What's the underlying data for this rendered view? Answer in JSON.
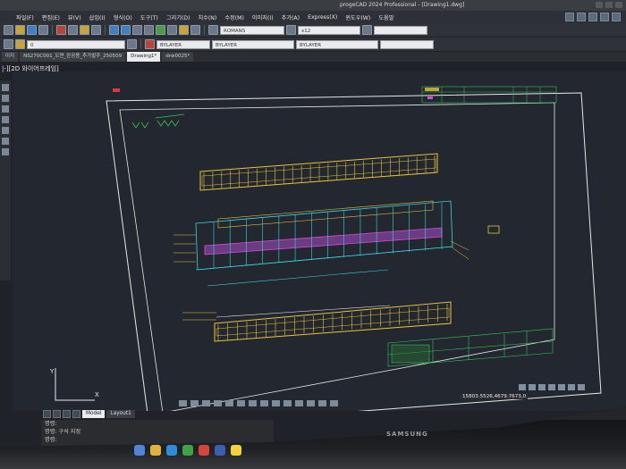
{
  "window": {
    "title": "progeCAD 2024 Professional - [Drawing1.dwg]"
  },
  "menu": {
    "items": [
      "파일(F)",
      "편집(E)",
      "뷰(V)",
      "삽입(I)",
      "형식(O)",
      "도구(T)",
      "그리기(D)",
      "치수(N)",
      "수정(M)",
      "이미지(I)",
      "추가(A)",
      "Express(X)",
      "윈도우(W)",
      "도움말"
    ]
  },
  "toolbar": {
    "font_combo": "ROMANS",
    "scale_combo": "x12",
    "color_combo": "BYLAYER",
    "linetype_combo": "BYLAYER",
    "lineweight_combo": "BYLAYER",
    "layer_combo": "0"
  },
  "doc_tabs": [
    {
      "label": "이지"
    },
    {
      "label": "NS270C001_도면_완공용_추가발주_250509"
    },
    {
      "label": "Drawing1*",
      "active": true
    },
    {
      "label": "drw0025*"
    }
  ],
  "view_label": "|-][2D 와이어프레임]",
  "model_tabs": [
    {
      "label": "Model",
      "active": true
    },
    {
      "label": "Layout1"
    }
  ],
  "coordinates": "15803.5526,4679.7673,0",
  "command_line": [
    "명령:",
    "명령: 구석 지정",
    "명령:"
  ],
  "monitor_brand": "SAMSUNG",
  "ucs": {
    "x_label": "X",
    "y_label": "Y"
  },
  "colors": {
    "canvas": "#222730",
    "frame": "#e8e8e8",
    "dim_yellow": "#e8c53a",
    "dim_cyan": "#3fd4e0",
    "rebar_magenta": "#d24fd0",
    "titleblock_green": "#39c35a"
  }
}
